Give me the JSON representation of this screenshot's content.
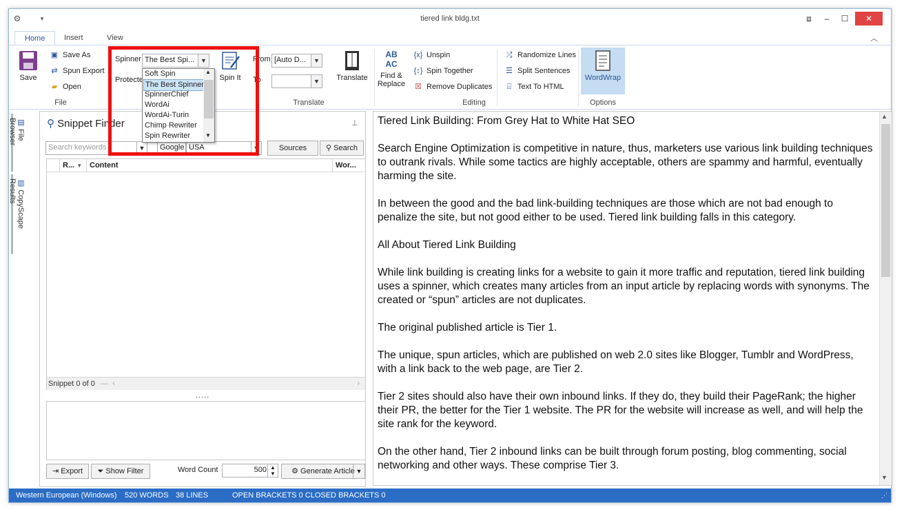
{
  "window": {
    "title": "tiered link bldg.txt"
  },
  "tabs": [
    "Home",
    "Insert",
    "View"
  ],
  "ribbon": {
    "file": {
      "label": "File",
      "save": "Save",
      "save_as": "Save As",
      "spun_export": "Spun Export",
      "open": "Open"
    },
    "spinner": {
      "spinner_label": "Spinner",
      "spinner_value": "The Best Spi...",
      "protected_label": "Protecte",
      "spin_it": "Spin It",
      "options": [
        "Soft Spin",
        "The Best Spinner",
        "SpinnerChief",
        "WordAi",
        "WordAi-Turin",
        "Chimp Rewriter",
        "Spin Rewriter"
      ],
      "selected_index": 1
    },
    "translate": {
      "label": "Translate",
      "from_label": "From",
      "from_value": "[Auto D...",
      "to_label": "To",
      "to_value": "",
      "translate_button": "Translate"
    },
    "editing": {
      "label": "Editing",
      "find_replace": "Find & Replace",
      "find_replace_icon_text": "AB AC",
      "unspin": "Unspin",
      "spin_together": "Spin Together",
      "remove_duplicates": "Remove Duplicates",
      "randomize_lines": "Randomize Lines",
      "split_sentences": "Split Sentences",
      "text_to_html": "Text To HTML"
    },
    "options": {
      "label": "Options",
      "wordwrap": "WordWrap"
    }
  },
  "side_tabs": [
    "File Browser",
    "CopyScape Results"
  ],
  "snippet_finder": {
    "title": "Snippet Finder",
    "search_placeholder": "Search keywords",
    "engine": "Google",
    "region": "USA",
    "sources_button": "Sources",
    "search_button": "Search",
    "columns": [
      "R...",
      "Content",
      "Wor..."
    ],
    "footer": "Snippet 0 of 0",
    "splitter": "....."
  },
  "bottom_bar": {
    "export": "Export",
    "show_filter": "Show Filter",
    "word_count_label": "Word Count",
    "word_count_value": "500",
    "generate_article": "Generate Article"
  },
  "document": {
    "paragraphs": [
      "Tiered Link Building: From Grey Hat to White Hat SEO",
      "Search Engine Optimization is competitive in nature, thus, marketers use various link building techniques to outrank rivals. While some tactics are highly acceptable, others are spammy and harmful, eventually harming the site.",
      "In between the good and the bad link-building techniques are those which are not bad enough to penalize the site, but not good either to be used. Tiered link building falls in this category.",
      "All About Tiered Link Building",
      "While link building is creating links for a website to gain it more traffic and reputation, tiered link building uses a spinner, which creates many articles from an input article by replacing words with synonyms. The created or “spun” articles are not duplicates.",
      "The original published article is Tier 1.",
      "The unique, spun articles, which are published on web 2.0 sites like Blogger, Tumblr and WordPress, with a link back to the web page, are Tier 2.",
      "Tier 2 sites should also have their own inbound links. If they do, they build their PageRank; the higher their PR, the better for the Tier 1 website. The PR for the website will increase as well, and will help the site rank for the keyword.",
      "On the other hand, Tier 2 inbound links can be built through forum posting, blog commenting, social networking and other ways. These comprise Tier 3."
    ]
  },
  "status_bar": {
    "encoding": "Western European (Windows)",
    "words": "520 WORDS",
    "lines": "38 LINES",
    "brackets": "OPEN BRACKETS 0 CLOSED BRACKETS 0"
  },
  "colors": {
    "accent": "#2b579a",
    "status_bar": "#2b6cc4",
    "highlight": "#ee1111",
    "selected": "#cce4f7"
  },
  "icons": [
    "gear-icon",
    "save-icon",
    "save-as-icon",
    "spun-export-icon",
    "open-folder-icon",
    "spin-it-icon",
    "translate-icon",
    "find-replace-icon",
    "unspin-icon",
    "spin-together-icon",
    "remove-duplicates-icon",
    "randomize-lines-icon",
    "split-sentences-icon",
    "text-to-html-icon",
    "wordwrap-icon",
    "search-icon",
    "pin-icon",
    "export-icon",
    "filter-icon",
    "generate-icon"
  ]
}
